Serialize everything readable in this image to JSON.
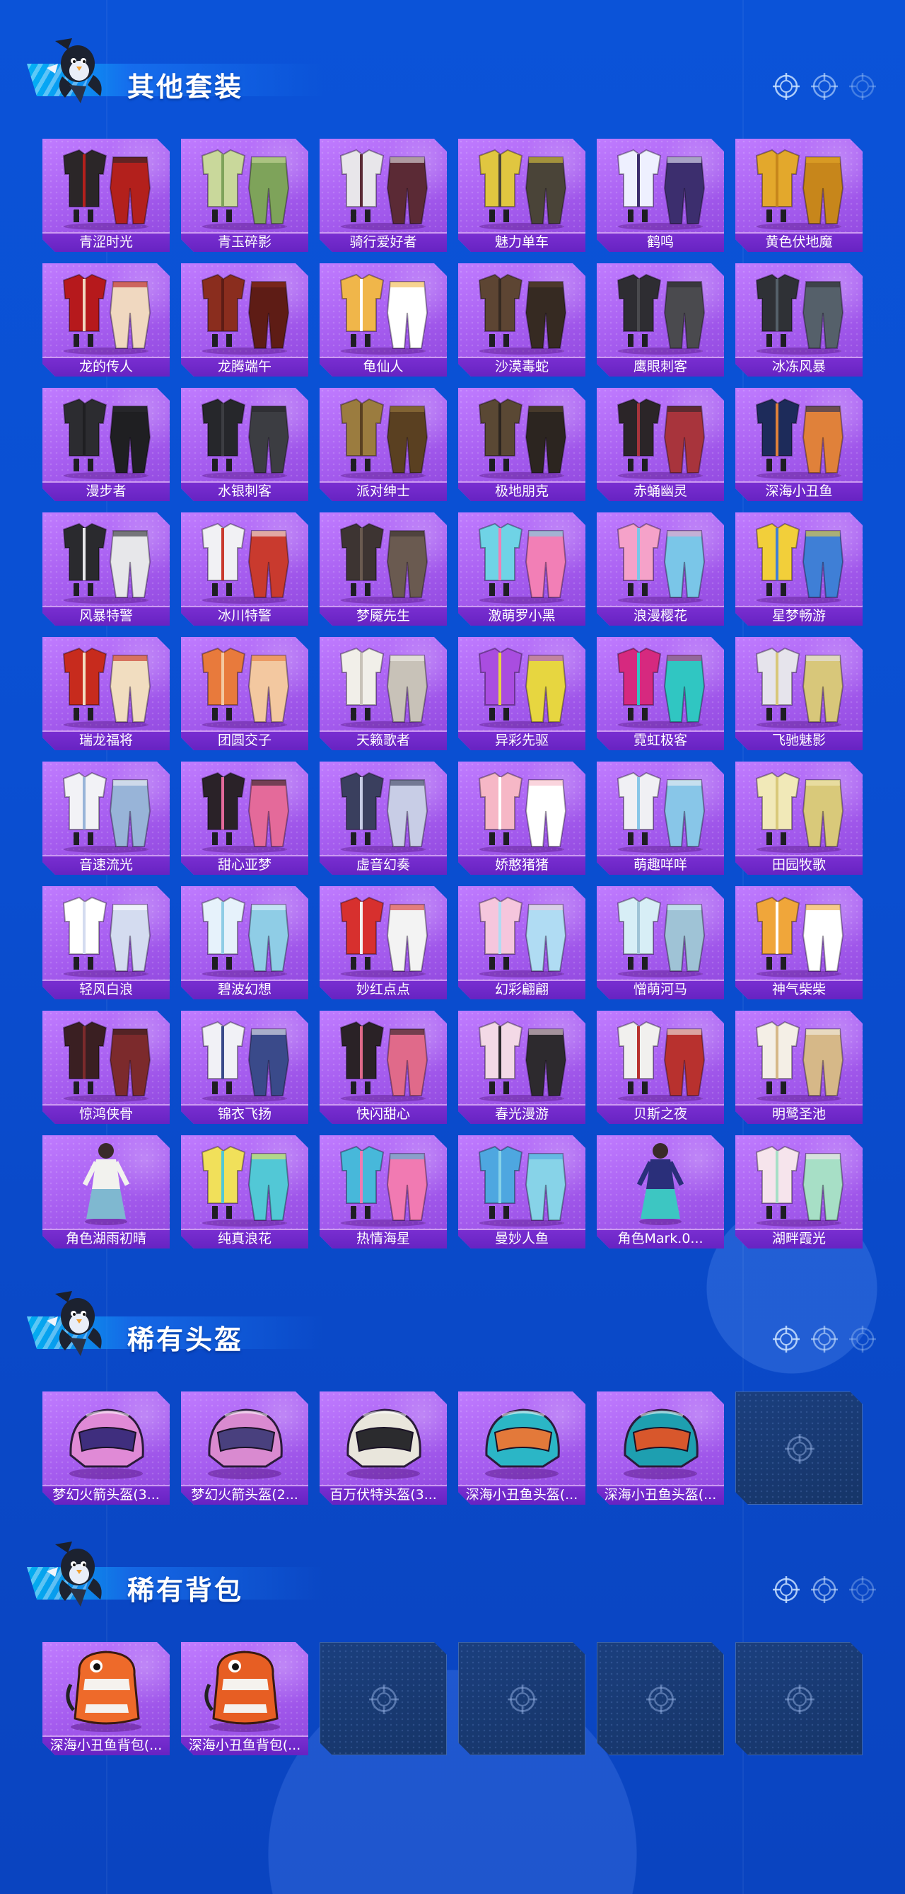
{
  "sections": [
    {
      "title": "其他套装",
      "items": [
        {
          "label": "青涩时光",
          "kind": "outfit",
          "colors": [
            "#2b2628",
            "#b3201c"
          ]
        },
        {
          "label": "青玉碎影",
          "kind": "outfit",
          "colors": [
            "#c9d89b",
            "#7ea35a"
          ]
        },
        {
          "label": "骑行爱好者",
          "kind": "outfit",
          "colors": [
            "#e8e6ea",
            "#5b2a35"
          ]
        },
        {
          "label": "魅力单车",
          "kind": "outfit",
          "colors": [
            "#e0c640",
            "#4a4438"
          ]
        },
        {
          "label": "鹤鸣",
          "kind": "outfit",
          "colors": [
            "#eef0ff",
            "#3c2e6e"
          ]
        },
        {
          "label": "黄色伏地魔",
          "kind": "outfit",
          "colors": [
            "#e3a82c",
            "#c7861b"
          ]
        },
        {
          "label": "龙的传人",
          "kind": "outfit",
          "colors": [
            "#b6191c",
            "#f0d8c0"
          ]
        },
        {
          "label": "龙腾端午",
          "kind": "outfit",
          "colors": [
            "#8a2d1e",
            "#5e1c15"
          ]
        },
        {
          "label": "龟仙人",
          "kind": "outfit",
          "colors": [
            "#f0b64a",
            "#ffffff"
          ]
        },
        {
          "label": "沙漠毒蛇",
          "kind": "outfit",
          "colors": [
            "#5d4533",
            "#362a22"
          ]
        },
        {
          "label": "鹰眼刺客",
          "kind": "outfit",
          "colors": [
            "#2e2d32",
            "#4a4a4e"
          ]
        },
        {
          "label": "冰冻风暴",
          "kind": "outfit",
          "colors": [
            "#2f3136",
            "#55606a"
          ]
        },
        {
          "label": "漫步者",
          "kind": "outfit",
          "colors": [
            "#2c2c30",
            "#1f1f22"
          ]
        },
        {
          "label": "水银刺客",
          "kind": "outfit",
          "colors": [
            "#26272b",
            "#3c3d42"
          ]
        },
        {
          "label": "派对绅士",
          "kind": "outfit",
          "colors": [
            "#9b7c3f",
            "#5a4021"
          ]
        },
        {
          "label": "极地朋克",
          "kind": "outfit",
          "colors": [
            "#5a4834",
            "#2c2520"
          ]
        },
        {
          "label": "赤蛹幽灵",
          "kind": "outfit",
          "colors": [
            "#2b2528",
            "#a8343c"
          ]
        },
        {
          "label": "深海小丑鱼",
          "kind": "outfit",
          "colors": [
            "#1d2b5a",
            "#e0813a"
          ]
        },
        {
          "label": "风暴特警",
          "kind": "outfit",
          "colors": [
            "#2a2a2e",
            "#e7e7ea"
          ]
        },
        {
          "label": "冰川特警",
          "kind": "outfit",
          "colors": [
            "#f1f1f4",
            "#c93a2e"
          ]
        },
        {
          "label": "梦魇先生",
          "kind": "outfit",
          "colors": [
            "#3d3432",
            "#6a5a50"
          ]
        },
        {
          "label": "激萌罗小黑",
          "kind": "outfit",
          "colors": [
            "#6fd3e6",
            "#f27fb6"
          ]
        },
        {
          "label": "浪漫樱花",
          "kind": "outfit",
          "colors": [
            "#f5a2c9",
            "#7ac6e8"
          ]
        },
        {
          "label": "星梦畅游",
          "kind": "outfit",
          "colors": [
            "#f2cf3a",
            "#3f7fd6"
          ]
        },
        {
          "label": "瑞龙福将",
          "kind": "outfit",
          "colors": [
            "#c72b1d",
            "#f1ddc0"
          ]
        },
        {
          "label": "团圆交子",
          "kind": "outfit",
          "colors": [
            "#e87a3c",
            "#f3c8a0"
          ]
        },
        {
          "label": "天籁歌者",
          "kind": "outfit",
          "colors": [
            "#f1efe9",
            "#c8c2b8"
          ]
        },
        {
          "label": "异彩先驱",
          "kind": "outfit",
          "colors": [
            "#a94de0",
            "#e7d640"
          ]
        },
        {
          "label": "霓虹极客",
          "kind": "outfit",
          "colors": [
            "#d6297f",
            "#30c6c2"
          ]
        },
        {
          "label": "飞驰魅影",
          "kind": "outfit",
          "colors": [
            "#e6e4ec",
            "#d8c77a"
          ]
        },
        {
          "label": "音速流光",
          "kind": "outfit",
          "colors": [
            "#f2f2f6",
            "#98b4d8"
          ]
        },
        {
          "label": "甜心亚梦",
          "kind": "outfit",
          "colors": [
            "#2a2228",
            "#e46a9a"
          ]
        },
        {
          "label": "虚音幻奏",
          "kind": "outfit",
          "colors": [
            "#3a3f5e",
            "#c8cde6"
          ]
        },
        {
          "label": "娇憨猪猪",
          "kind": "outfit",
          "colors": [
            "#f6b7c6",
            "#ffffff"
          ]
        },
        {
          "label": "萌趣咩咩",
          "kind": "outfit",
          "colors": [
            "#f0f0f4",
            "#88c6e8"
          ]
        },
        {
          "label": "田园牧歌",
          "kind": "outfit",
          "colors": [
            "#f1e9b8",
            "#d9c97a"
          ]
        },
        {
          "label": "轻风白浪",
          "kind": "outfit",
          "colors": [
            "#ffffff",
            "#d4dcf0"
          ]
        },
        {
          "label": "碧波幻想",
          "kind": "outfit",
          "colors": [
            "#e6f2fb",
            "#8fcde6"
          ]
        },
        {
          "label": "妙红点点",
          "kind": "outfit",
          "colors": [
            "#d7302e",
            "#f3f3f3"
          ]
        },
        {
          "label": "幻彩翩翩",
          "kind": "outfit",
          "colors": [
            "#f5c6dd",
            "#b0dcf3"
          ]
        },
        {
          "label": "憎萌河马",
          "kind": "outfit",
          "colors": [
            "#d7eef6",
            "#9fc3d6"
          ]
        },
        {
          "label": "神气柴柴",
          "kind": "outfit",
          "colors": [
            "#f0a63a",
            "#ffffff"
          ]
        },
        {
          "label": "惊鸿侠骨",
          "kind": "outfit",
          "colors": [
            "#3a1f22",
            "#7c2a2c"
          ]
        },
        {
          "label": "锦衣飞扬",
          "kind": "outfit",
          "colors": [
            "#f1f1f6",
            "#3a4a8a"
          ]
        },
        {
          "label": "快闪甜心",
          "kind": "outfit",
          "colors": [
            "#2a2226",
            "#e06a8a"
          ]
        },
        {
          "label": "春光漫游",
          "kind": "outfit",
          "colors": [
            "#f3d9e6",
            "#2d2a2e"
          ]
        },
        {
          "label": "贝斯之夜",
          "kind": "outfit",
          "colors": [
            "#f1f0ee",
            "#b8312e"
          ]
        },
        {
          "label": "明鹭圣池",
          "kind": "outfit",
          "colors": [
            "#f4efe6",
            "#d6b888"
          ]
        },
        {
          "label": "角色湖雨初晴",
          "kind": "character",
          "colors": [
            "#f2f2ee",
            "#7fb8d0"
          ]
        },
        {
          "label": "纯真浪花",
          "kind": "outfit",
          "colors": [
            "#f1e05a",
            "#52c8d6"
          ]
        },
        {
          "label": "热情海星",
          "kind": "outfit",
          "colors": [
            "#47b8da",
            "#f17ab2"
          ]
        },
        {
          "label": "曼妙人鱼",
          "kind": "outfit",
          "colors": [
            "#4ea7e0",
            "#87d3e8"
          ]
        },
        {
          "label": "角色Mark.0...",
          "kind": "character",
          "colors": [
            "#2a2f7a",
            "#3dc6c2"
          ]
        },
        {
          "label": "湖畔霞光",
          "kind": "outfit",
          "colors": [
            "#f6e4ec",
            "#a7dfc6"
          ]
        }
      ]
    },
    {
      "title": "稀有头盔",
      "items": [
        {
          "label": "梦幻火箭头盔(3...",
          "kind": "helmet",
          "colors": [
            "#e08ad6",
            "#3f2e7e"
          ]
        },
        {
          "label": "梦幻火箭头盔(2...",
          "kind": "helmet",
          "colors": [
            "#d98ad0",
            "#49407e"
          ]
        },
        {
          "label": "百万伏特头盔(3...",
          "kind": "helmet",
          "colors": [
            "#e9e6dc",
            "#2b2b2e"
          ]
        },
        {
          "label": "深海小丑鱼头盔(...",
          "kind": "helmet",
          "colors": [
            "#2bb6c6",
            "#e3793a"
          ]
        },
        {
          "label": "深海小丑鱼头盔(...",
          "kind": "helmet",
          "colors": [
            "#1e9fb0",
            "#d8572c"
          ]
        },
        {
          "label": "",
          "kind": "empty"
        }
      ]
    },
    {
      "title": "稀有背包",
      "items": [
        {
          "label": "深海小丑鱼背包(...",
          "kind": "backpack",
          "colors": [
            "#ee6a2a",
            "#f5f2ee"
          ]
        },
        {
          "label": "深海小丑鱼背包(...",
          "kind": "backpack",
          "colors": [
            "#e75e23",
            "#f5f2ee"
          ]
        },
        {
          "label": "",
          "kind": "empty"
        },
        {
          "label": "",
          "kind": "empty"
        },
        {
          "label": "",
          "kind": "empty"
        },
        {
          "label": "",
          "kind": "empty"
        }
      ]
    }
  ],
  "colors": {
    "background": "#0b50d5",
    "card": "#a75ef0",
    "card_label": "#6b26c6",
    "empty_slot": "#1a3a74"
  },
  "icons": {
    "section_mascot": "penguin-mascot-icon",
    "section_deco": "crosshair-icon",
    "empty_slot": "crosshair-icon"
  }
}
